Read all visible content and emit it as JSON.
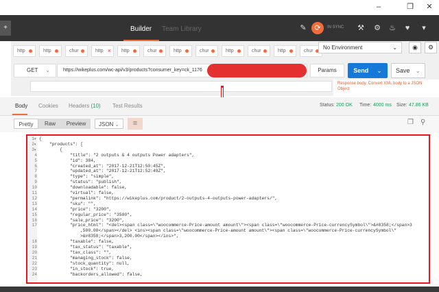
{
  "header": {
    "builder": "Builder",
    "team_library": "Team Library",
    "sync_status": "IN SYNC"
  },
  "left_tab": "+",
  "request_tabs": [
    {
      "label": "http",
      "state": "dot"
    },
    {
      "label": "http",
      "state": "dot"
    },
    {
      "label": "chur",
      "state": "dot"
    },
    {
      "label": "http",
      "state": "close"
    },
    {
      "label": "http",
      "state": "dot"
    },
    {
      "label": "chur",
      "state": "dot"
    },
    {
      "label": "http",
      "state": "dot"
    },
    {
      "label": "chur",
      "state": "dot"
    },
    {
      "label": "http",
      "state": "dot"
    },
    {
      "label": "chur",
      "state": "dot"
    },
    {
      "label": "http",
      "state": "dot"
    },
    {
      "label": "chur",
      "state": "dot"
    }
  ],
  "environment": {
    "selected": "No Environment"
  },
  "request": {
    "method": "GET",
    "url": "https://wikeplus.com/wc-api/v3/products?consumer_key=ck_1176",
    "params_label": "Params",
    "send_label": "Send",
    "save_label": "Save",
    "help_text": "Response body. Convert XML body to a JSON Object"
  },
  "response_tabs": {
    "body": "Body",
    "cookies": "Cookies",
    "headers": "Headers",
    "headers_count": "(10)",
    "test_results": "Test Results"
  },
  "status": {
    "status_label": "Status:",
    "status_value": "200 OK",
    "time_label": "Time:",
    "time_value": "4000 ms",
    "size_label": "Size:",
    "size_value": "47.86 KB"
  },
  "view": {
    "pretty": "Pretty",
    "raw": "Raw",
    "preview": "Preview",
    "format": "JSON"
  },
  "code_lines": [
    {
      "n": "1",
      "fold": true,
      "indent": 0,
      "text": "{"
    },
    {
      "n": "2",
      "fold": true,
      "indent": 1,
      "text": "\"products\": ["
    },
    {
      "n": "3",
      "fold": true,
      "indent": 2,
      "text": "{"
    },
    {
      "n": "4",
      "indent": 3,
      "text": "\"title\": \"2 outputs & 4 outputs Power adapters\","
    },
    {
      "n": "5",
      "indent": 3,
      "text": "\"id\": 384,"
    },
    {
      "n": "6",
      "indent": 3,
      "text": "\"created_at\": \"2017-12-21T12:50:45Z\","
    },
    {
      "n": "7",
      "indent": 3,
      "text": "\"updated_at\": \"2017-12-21T12:52:49Z\","
    },
    {
      "n": "8",
      "indent": 3,
      "text": "\"type\": \"simple\","
    },
    {
      "n": "9",
      "indent": 3,
      "text": "\"status\": \"publish\","
    },
    {
      "n": "10",
      "indent": 3,
      "text": "\"downloadable\": false,"
    },
    {
      "n": "11",
      "indent": 3,
      "text": "\"virtual\": false,"
    },
    {
      "n": "12",
      "indent": 3,
      "text": "\"permalink\": \"https://wikeplus.com/product/2-outputs-4-outputs-power-adapters/\","
    },
    {
      "n": "13",
      "indent": 3,
      "text": "\"sku\": \"\","
    },
    {
      "n": "14",
      "indent": 3,
      "text": "\"price\": \"3200\","
    },
    {
      "n": "15",
      "indent": 3,
      "text": "\"regular_price\": \"3500\","
    },
    {
      "n": "16",
      "indent": 3,
      "text": "\"sale_price\": \"3200\","
    },
    {
      "n": "17",
      "indent": 3,
      "text": "\"price_html\": \"<del><span class=\\\"woocommerce-Price-amount amount\\\"><span class=\\\"woocommerce-Price-currencySymbol\\\">&#8358;</span>3"
    },
    {
      "n": "",
      "indent": 4,
      "text": ",500.00</span></del> <ins><span class=\\\"woocommerce-Price-amount amount\\\"><span class=\\\"woocommerce-Price-currencySymbol\\\""
    },
    {
      "n": "",
      "indent": 4,
      "text": ">&#8358;</span>3,200.00</span></ins>\","
    },
    {
      "n": "18",
      "indent": 3,
      "text": "\"taxable\": false,"
    },
    {
      "n": "19",
      "indent": 3,
      "text": "\"tax_status\": \"taxable\","
    },
    {
      "n": "20",
      "indent": 3,
      "text": "\"tax_class\": \"\","
    },
    {
      "n": "21",
      "indent": 3,
      "text": "\"managing_stock\": false,"
    },
    {
      "n": "22",
      "indent": 3,
      "text": "\"stock_quantity\": null,"
    },
    {
      "n": "23",
      "indent": 3,
      "text": "\"in_stock\": true,"
    },
    {
      "n": "24",
      "indent": 3,
      "text": "\"backorders_allowed\": false,"
    }
  ]
}
